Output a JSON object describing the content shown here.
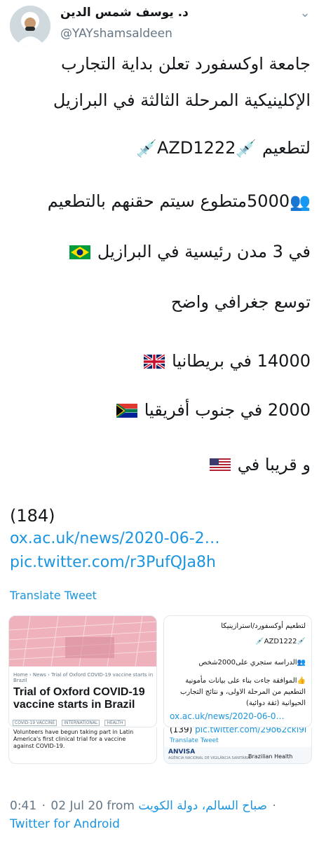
{
  "author": {
    "name": "د. يوسف شمس الدين",
    "handle": "@YAYshamsaldeen"
  },
  "tweet": {
    "lines": [
      "جامعة اوكسفورد تعلن بداية التجارب",
      "الإكلينيكية المرحلة الثالثة في البرازيل",
      "لتطعيم",
      "AZD1222",
      "5000متطوع سيتم حقنهم بالتطعيم",
      "في 3 مدن رئيسية في البرازيل",
      "توسع جغرافي واضح",
      "14000 في بريطانيا",
      "2000 في جنوب أفريقيا",
      "و قريبا في"
    ],
    "count": "(184)",
    "link": "ox.ac.uk/news/2020-06-2…",
    "pic": "pic.twitter.com/r3PufQJa8h",
    "translate": "Translate Tweet"
  },
  "card_left": {
    "crumb": "Home  ›  News  ›  Trial of Oxford COVID-19 vaccine starts in Brazil",
    "title": "Trial of Oxford COVID-19 vaccine starts in Brazil",
    "tags": [
      "COVID-19 VACCINE",
      "INTERNATIONAL",
      "HEALTH"
    ],
    "description": "Volunteers have begun taking part in Latin America's first clinical trial for a vaccine against COVID-19."
  },
  "card_right": {
    "line1": "لتطعيم أوكسفورد/استرازينيكا",
    "line2": "AZD1222",
    "line3": "الدراسة ستجري على2000شخص",
    "line4": "الموافقة جاءت بناء على بيانات مأمونية",
    "line5": "التطعيم من المرحلة الاولى، و نتائج التجارب",
    "line6": "الحيوانية (ثقة دوائية)",
    "link": "ox.ac.uk/news/2020-06-0…",
    "count": "(139)",
    "pic": "pic.twitter.com/29o62ckl9l",
    "translate": "Translate Tweet",
    "anvisa_title": "ANVISA",
    "anvisa_sub": "AGÊNCIA NACIONAL DE VIGILÂNCIA SANITÁRIA",
    "anvisa_right": "Brazilian Health"
  },
  "meta": {
    "time": "0:41",
    "date": "02 Jul 20",
    "from": "from",
    "location": "صباح السالم، دولة الكويت",
    "client": "Twitter for Android"
  },
  "colors": {
    "link": "#1b95e0",
    "secondary_text": "#657786"
  }
}
